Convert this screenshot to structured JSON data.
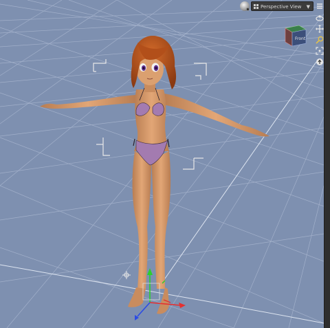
{
  "viewport": {
    "camera_label": "Perspective View",
    "cube_face_label": "Front",
    "background_color": "#7e90b0",
    "grid_color": "#a9b6cf"
  },
  "toolbar_icons": [
    {
      "name": "menu-lines-icon"
    },
    {
      "name": "orbit-camera-icon"
    },
    {
      "name": "pan-camera-icon"
    },
    {
      "name": "zoom-key-icon"
    },
    {
      "name": "frame-icon"
    },
    {
      "name": "reset-view-icon"
    }
  ],
  "figure": {
    "description_type": "3d-character",
    "skin_color": "#d79a6a",
    "hair_color": "#b8561c",
    "swimsuit_color": "#a37bb0"
  },
  "gizmo": {
    "x_axis_color": "#e53030",
    "y_axis_color": "#2bd02b",
    "z_axis_color": "#2b4be5"
  }
}
